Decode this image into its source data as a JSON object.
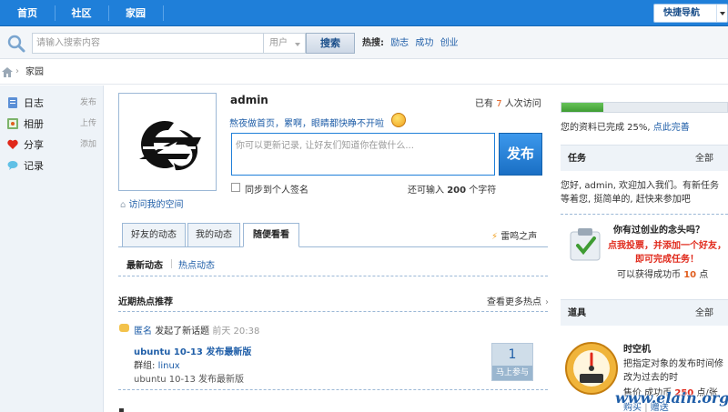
{
  "nav": {
    "items": [
      "首页",
      "社区",
      "家园"
    ],
    "quick_nav": "快捷导航"
  },
  "search": {
    "placeholder": "请输入搜索内容",
    "type": "用户",
    "button": "搜索",
    "hot_label": "热搜:",
    "hot_links": [
      "励志",
      "成功",
      "创业"
    ]
  },
  "breadcrumb": {
    "current": "家园"
  },
  "sidebar": {
    "items": [
      {
        "label": "日志",
        "action": "发布",
        "icon": "journal-icon"
      },
      {
        "label": "相册",
        "action": "上传",
        "icon": "album-icon"
      },
      {
        "label": "分享",
        "action": "添加",
        "icon": "share-heart-icon"
      },
      {
        "label": "记录",
        "action": "",
        "icon": "record-bubble-icon"
      }
    ]
  },
  "profile": {
    "username": "admin",
    "visits_pre": "已有",
    "visits_count": "7",
    "visits_post": "人次访问",
    "status": "熬夜做首页，累啊，眼睛都快睁不开啦",
    "visit_space": "访问我的空间",
    "input_placeholder": "你可以更新记录, 让好友们知道你在做什么...",
    "publish": "发布",
    "sync_label": "同步到个人签名",
    "remain_pre": "还可输入",
    "remain_count": "200",
    "remain_post": "个字符"
  },
  "tabs": {
    "items": [
      "好友的动态",
      "我的动态",
      "随便看看"
    ],
    "active": 2,
    "thunder": "雷鸣之声",
    "sub": [
      "最新动态",
      "热点动态"
    ]
  },
  "hot": {
    "title": "近期热点推荐",
    "more": "查看更多热点",
    "feed": {
      "who": "匿名",
      "action": "发起了新话题",
      "time": "前天 20:38",
      "title": "ubuntu 10-13 发布最新版",
      "group_label": "群组:",
      "group": "linux",
      "desc": "ubuntu 10-13 发布最新版",
      "count": "1",
      "join": "马上参与"
    }
  },
  "right": {
    "progress_pct": 25,
    "progress_text": "您的资料已完成 25%,",
    "progress_link": "点此完善",
    "task_title": "任务",
    "task_all": "全部",
    "task_text": "您好, admin, 欢迎加入我们。有新任务等着您, 挺简单的, 赶快来参加吧",
    "task_q": "你有过创业的念头吗？",
    "task_red": "点我投票，并添加一个好友，即可完成任务！",
    "task_reward_pre": "可以获得成功币",
    "task_reward_num": "10",
    "task_reward_post": "点",
    "tools_title": "道具",
    "tools_all": "全部",
    "tool_name": "时空机",
    "tool_desc": "把指定对象的发布时间修改为过去的时",
    "tool_price_pre": "售价 成功币",
    "tool_price_num": "250",
    "tool_price_post": "点/张",
    "tool_buy": "购买",
    "tool_gift": "赠送"
  },
  "watermark": "www.elain.org",
  "colors": {
    "nav_blue": "#1f7fd9",
    "link_blue": "#1f5ea8",
    "sidebar_bg": "#eef3f8",
    "progress_green": "#4cae3f",
    "accent_orange": "#e05e1f",
    "alert_red": "#e0281a"
  }
}
